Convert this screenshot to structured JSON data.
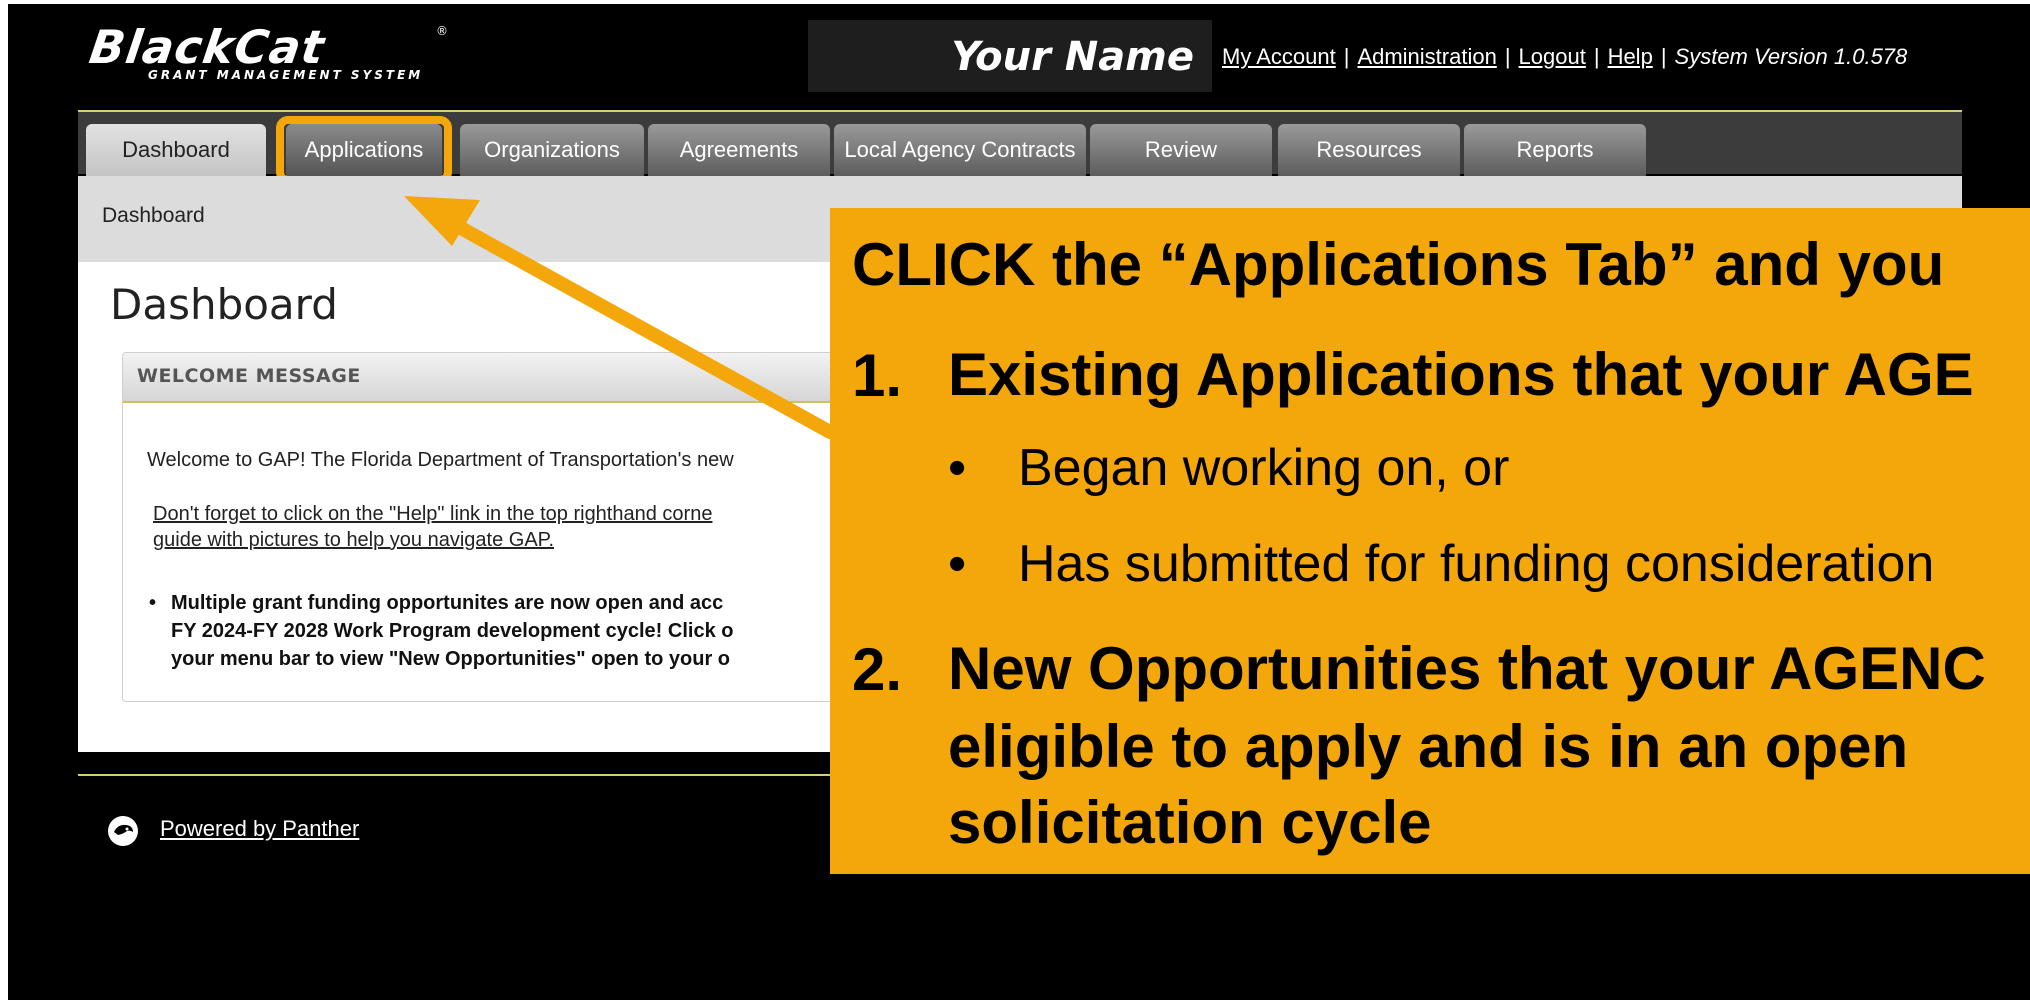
{
  "brand": {
    "logo_text": "BlackCat",
    "logo_subtitle": "GRANT MANAGEMENT SYSTEM",
    "registered_mark": "®"
  },
  "header": {
    "user_name": "Your Name",
    "links": [
      "My Account",
      "Administration",
      "Logout",
      "Help"
    ],
    "version": "System Version  1.0.578"
  },
  "tabs": [
    "Dashboard",
    "Applications",
    "Organizations",
    "Agreements",
    "Local Agency Contracts",
    "Review",
    "Resources",
    "Reports"
  ],
  "breadcrumb": "Dashboard",
  "page_title": "Dashboard",
  "welcome": {
    "heading": "WELCOME MESSAGE",
    "intro": "Welcome to GAP!  The Florida Department of Transportation's new",
    "help_line1": "Don't forget to click on the \"Help\" link in the top righthand corne",
    "help_line2": "guide with pictures to help you navigate GAP.",
    "bullet_line1": "Multiple grant funding opportunites are now open and acc",
    "bullet_line2": "FY 2024-FY 2028 Work Program development cycle!  Click o",
    "bullet_line3": "your menu bar to view \"New Opportunities\" open to your o"
  },
  "footer": {
    "powered_by": "Powered by Panther"
  },
  "callout": {
    "heading": "CLICK the “Applications Tab” and you",
    "item1_num": "1.",
    "item1_text": "Existing Applications that your AGE",
    "item1_sub1": "Began working on, or",
    "item1_sub2": "Has submitted for funding consideration",
    "item2_num": "2.",
    "item2_line1": "New Opportunities that your AGENC",
    "item2_line2": "eligible to apply and is in an open",
    "item2_line3": "solicitation cycle",
    "bullet": "•"
  },
  "colors": {
    "accent_orange": "#f3a70b",
    "background": "#000000",
    "rule_gold": "#d8cf7a"
  }
}
